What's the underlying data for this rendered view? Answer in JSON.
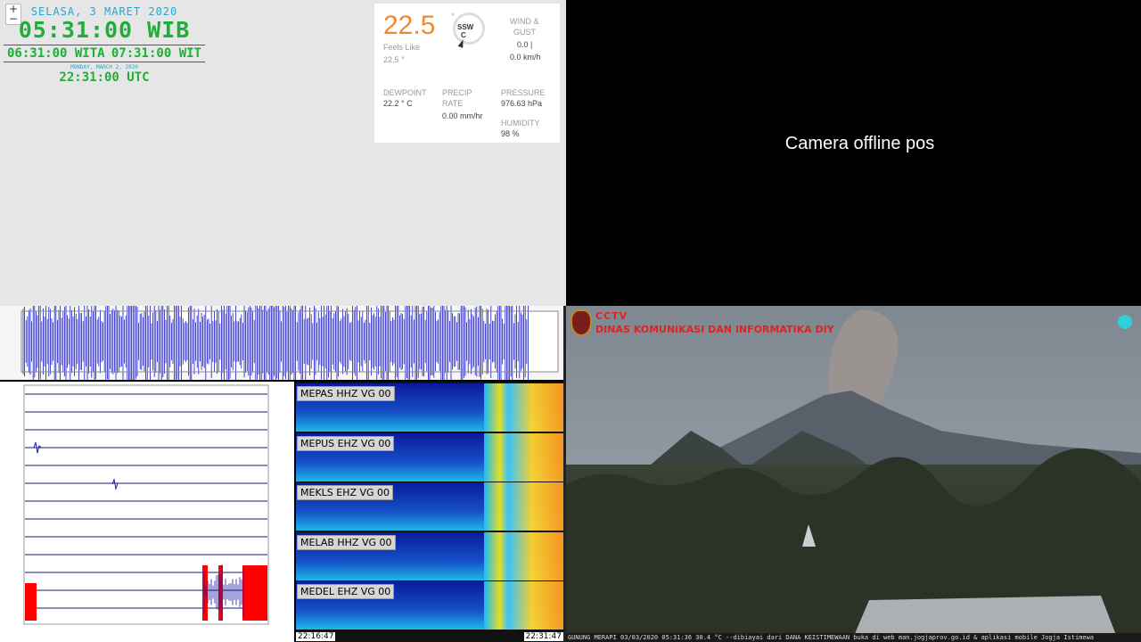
{
  "clock": {
    "zoom_in": "+",
    "zoom_out": "−",
    "date_local": "SELASA, 3 MARET 2020",
    "time_wib": "05:31:00 WIB",
    "time_wita": "06:31:00 WITA",
    "time_wit": "07:31:00 WIT",
    "date_utc": "MONDAY, MARCH 2, 2020",
    "time_utc": "22:31:00 UTC"
  },
  "weather": {
    "temperature": "22.5",
    "degree_mark": "°",
    "wind_dir": "SSW",
    "wind_dir_sub": "C",
    "feels_like_label": "Feels Like",
    "feels_like_value": "22.5 °",
    "wind_label": "WIND &",
    "gust_label": "GUST",
    "wind_value": "0.0 |",
    "gust_value": "0.0 km/h",
    "dewpoint_label": "DEWPOINT",
    "dewpoint_value": "22.2 ° C",
    "precip_label": "PRECIP",
    "rate_label": "RATE",
    "precip_value": "0.00  mm/hr",
    "pressure_label": "PRESSURE",
    "pressure_value": "976.63  hPa",
    "humidity_label": "HUMIDITY",
    "humidity_value": "98  %"
  },
  "offline_camera": {
    "message": "Camera offline pos"
  },
  "spectrogram": {
    "channels": [
      "MEPAS HHZ VG 00",
      "MEPUS EHZ VG 00",
      "MEKLS EHZ VG 00",
      "MELAB HHZ VG 00",
      "MEDEL EHZ VG 00"
    ],
    "start_time": "22:16:47",
    "end_time": "22:31:47"
  },
  "live_camera": {
    "brand": "CCTV",
    "agency": "DINAS KOMUNIKASI DAN INFORMATIKA DIY",
    "caption": "GUNUNG MERAPI 03/03/2020 05:31:36  30.4 °C --dibiayai dari DANA KEISTIMEWAAN buka di web man.jogjaprov.go.id & aplikasi mobile Jogja Istimewa"
  },
  "colors": {
    "clock_green": "#1fae38",
    "clock_blue": "#2da3c9",
    "temp_orange": "#f08a2c",
    "cctv_red": "#e02222",
    "trace_blue": "#1a1ad0",
    "clip_red": "#ff0000"
  }
}
